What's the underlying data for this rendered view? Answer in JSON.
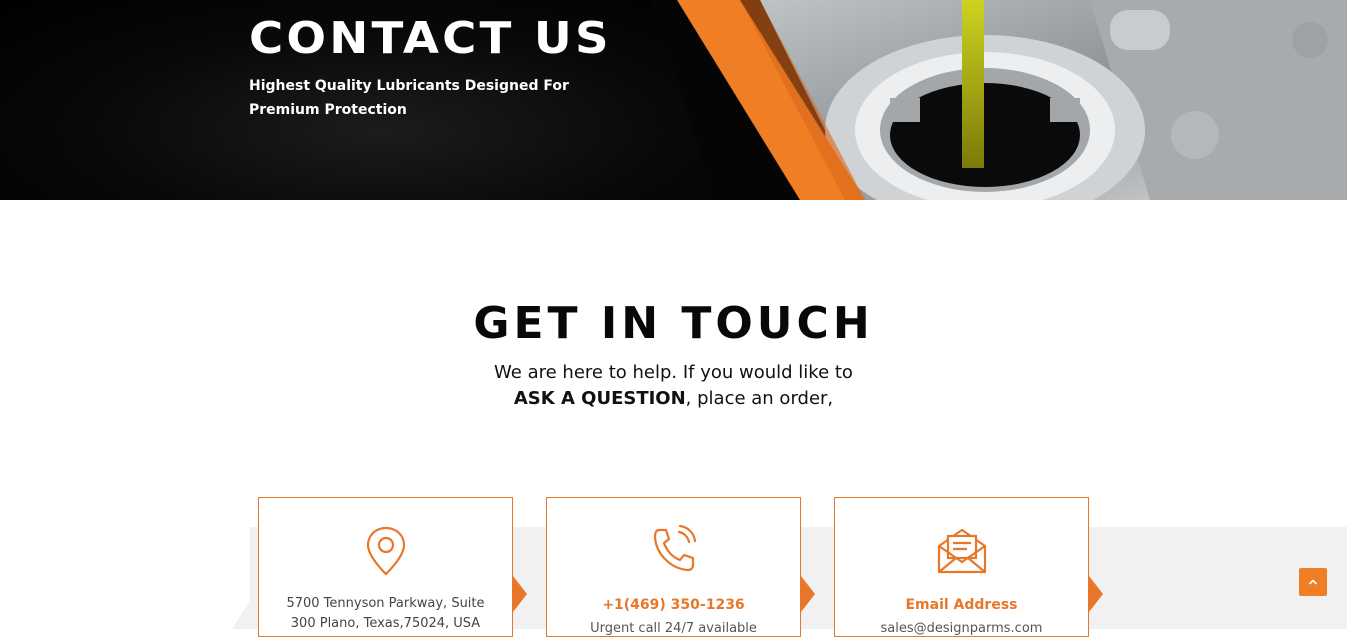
{
  "hero": {
    "title": "CONTACT US",
    "subtitle": "Highest Quality Lubricants Designed For Premium Protection"
  },
  "get_in_touch": {
    "title": "GET IN TOUCH",
    "line1": "We are here to help. If you would like to",
    "line2_bold": "ASK A QUESTION",
    "line2_rest": ", place an order,"
  },
  "cards": [
    {
      "icon": "location-pin-icon",
      "line1": "5700 Tennyson Parkway, Suite",
      "line2": "300 Plano, Texas,75024, USA"
    },
    {
      "icon": "phone-ringing-icon",
      "title": "+1(469) 350-1236",
      "text": "Urgent call 24/7 available"
    },
    {
      "icon": "envelope-letter-icon",
      "title": "Email Address",
      "text": "sales@designparms.com"
    }
  ],
  "scroll_top": {
    "icon": "chevron-up-icon"
  },
  "colors": {
    "accent": "#e8772a",
    "dark": "#050505",
    "grey_band": "#f1f1f1"
  }
}
